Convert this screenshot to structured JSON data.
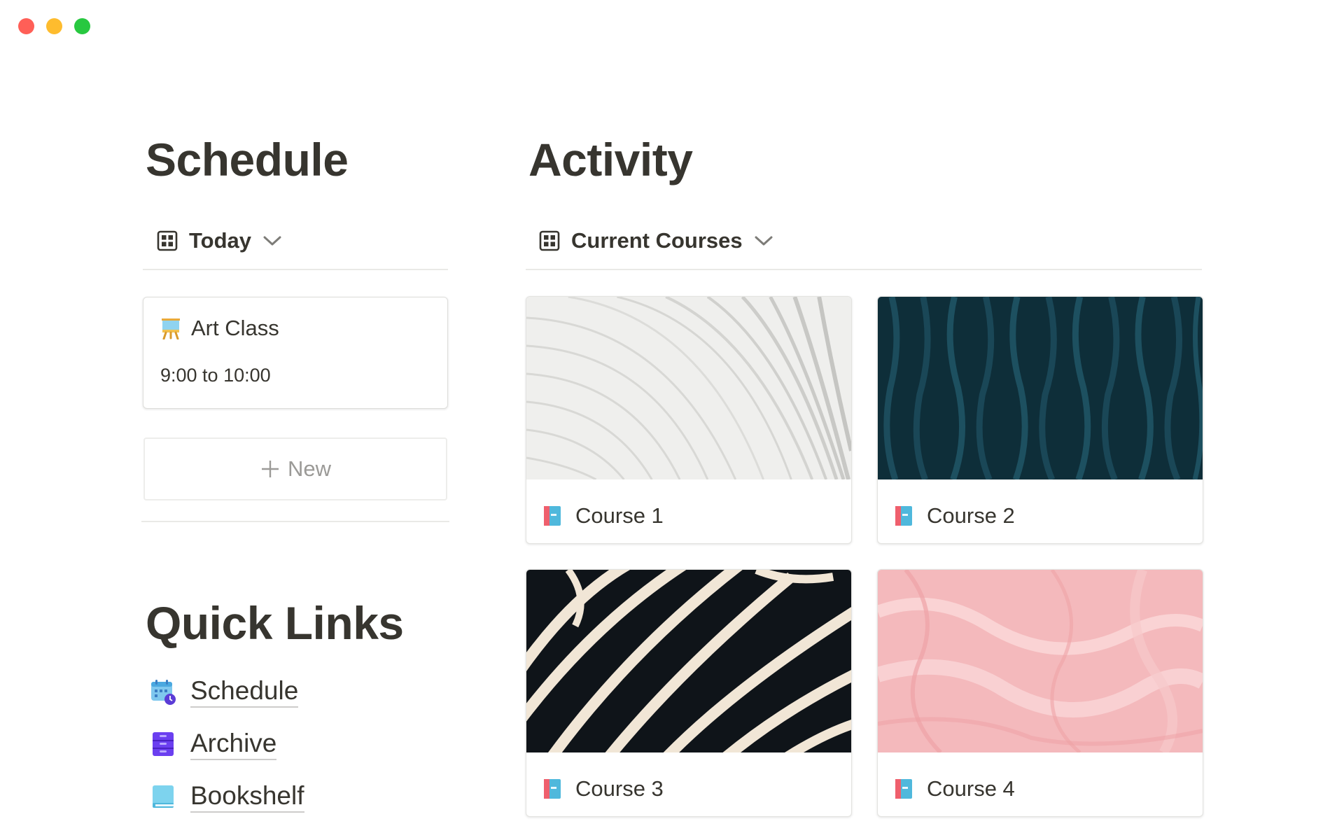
{
  "window": {
    "controls": [
      "close",
      "minimize",
      "maximize"
    ]
  },
  "schedule": {
    "heading": "Schedule",
    "view": {
      "label": "Today",
      "icon": "table-icon"
    },
    "events": [
      {
        "icon": "easel-icon",
        "title": "Art Class",
        "time": "9:00 to 10:00"
      }
    ],
    "new_label": "New"
  },
  "activity": {
    "heading": "Activity",
    "view": {
      "label": "Current Courses",
      "icon": "table-icon"
    },
    "courses": [
      {
        "name": "Course 1",
        "icon": "book-icon",
        "cover": "white-architectural-lines"
      },
      {
        "name": "Course 2",
        "icon": "book-icon",
        "cover": "dark-teal-waves"
      },
      {
        "name": "Course 3",
        "icon": "book-icon",
        "cover": "black-cream-stripes"
      },
      {
        "name": "Course 4",
        "icon": "book-icon",
        "cover": "pink-marble"
      }
    ]
  },
  "quick_links": {
    "heading": "Quick Links",
    "items": [
      {
        "label": "Schedule",
        "icon": "calendar-icon"
      },
      {
        "label": "Archive",
        "icon": "cabinet-icon"
      },
      {
        "label": "Bookshelf",
        "icon": "book-icon"
      }
    ]
  },
  "colors": {
    "text": "#37352f",
    "muted": "#9b9a97",
    "divider": "#e9e9e7"
  }
}
